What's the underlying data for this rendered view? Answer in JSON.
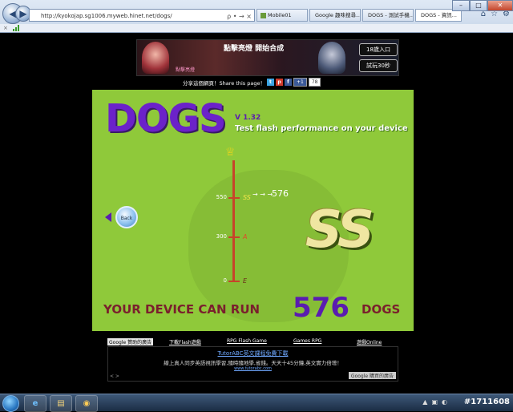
{
  "browser": {
    "address": "http://kyokojap.sg1006.myweb.hinet.net/dogs/",
    "address_tools": "ρ • → ×",
    "tabs": [
      {
        "label": "Mobile01"
      },
      {
        "label": "Google 趣味搜尋..."
      },
      {
        "label": "DOGS - 測試手機..."
      },
      {
        "label": "DOGS - 資訊..."
      }
    ],
    "win_icons": [
      "⌂",
      "☆",
      "⚙"
    ],
    "caption": {
      "min": "–",
      "max": "□",
      "close": "✕"
    },
    "favbar_text": "×"
  },
  "banner": {
    "headline": "點擊亮燈 開始合成",
    "subtext": "點擊亮燈",
    "btn_top": "18歲入口",
    "btn_bottom": "試玩30秒"
  },
  "share": {
    "label": "分享這個網頁！Share this page！",
    "count_a": "+1",
    "count_b": "78",
    "icons": [
      "t",
      "p",
      "f"
    ]
  },
  "flash": {
    "title": "DOGS",
    "version": "V 1.32",
    "tagline": "Test flash performance on your device",
    "back": "Back",
    "rank": "SS",
    "gauge": {
      "ticks": [
        {
          "value": "550",
          "grade": "SS"
        },
        {
          "value": "300",
          "grade": "A"
        },
        {
          "value": "0",
          "grade": "E"
        }
      ],
      "marker": "→ → →",
      "current": "576"
    },
    "result_prefix": "YOUR DEVICE CAN RUN",
    "result_number": "576",
    "result_suffix": "DOGS"
  },
  "ads": {
    "links": [
      {
        "label": "Google 贊助的廣告"
      },
      {
        "label": "下載Flash遊戲"
      },
      {
        "label": "RPG Flash Game"
      },
      {
        "label": "Games RPG"
      },
      {
        "label": "遊戲Online"
      }
    ],
    "title": "TutorABC英文課程免費下載",
    "desc": "線上真人同步英語視訊學習,隨時隨地學,省錢。天天十45分鐘,英文實力倍增！",
    "url": "www.tutorabc.com",
    "brand": "Google 購買的廣告",
    "nav": "< >"
  },
  "taskbar": {
    "apps": [
      "e",
      "▤",
      "◉"
    ],
    "tray": [
      "▲",
      "▣",
      "◐"
    ],
    "clock": "#1711608"
  }
}
